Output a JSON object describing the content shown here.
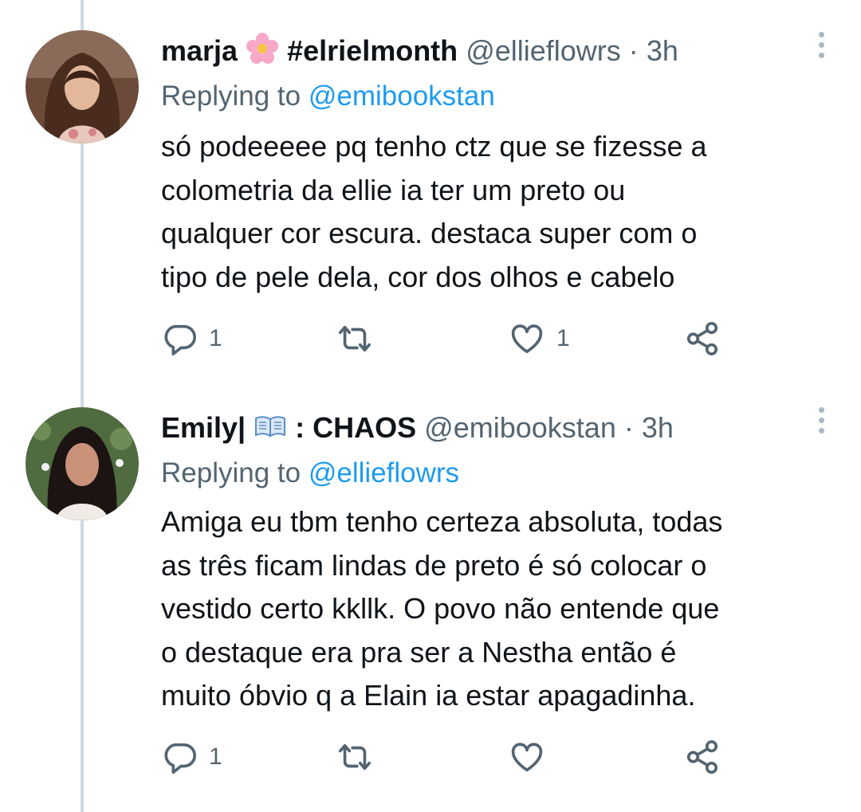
{
  "tweets": [
    {
      "display_name": "marja",
      "name_emoji": "cherry-blossom",
      "name_suffix": "#elrielmonth",
      "handle": "@ellieflowrs",
      "separator": "·",
      "time": "3h",
      "replying_prefix": "Replying to",
      "replying_to": "@emibookstan",
      "body_lines": [
        "só podeeeee pq tenho ctz que se fizesse a",
        "colometria da ellie ia ter um preto ou",
        "qualquer cor escura. destaca super com o",
        "tipo de pele dela, cor dos olhos e cabelo"
      ],
      "reply_count": "1",
      "retweet_count": "",
      "like_count": "1"
    },
    {
      "display_name": "Emily|",
      "name_emoji": "open-book",
      "name_suffix": ": CHAOS",
      "handle": "@emibookstan",
      "separator": "·",
      "time": "3h",
      "replying_prefix": "Replying to",
      "replying_to": "@ellieflowrs",
      "body_lines": [
        "Amiga eu tbm tenho certeza absoluta, todas",
        "as três ficam lindas de preto é só colocar o",
        "vestido certo kkllk. O povo não entende que",
        "o destaque era pra ser a Nestha então é",
        "muito óbvio q a Elain ia estar apagadinha."
      ],
      "reply_count": "1",
      "retweet_count": "",
      "like_count": ""
    }
  ],
  "colors": {
    "link": "#1d9bf0",
    "secondary_text": "#536471",
    "thread_line": "#cfd9de"
  }
}
